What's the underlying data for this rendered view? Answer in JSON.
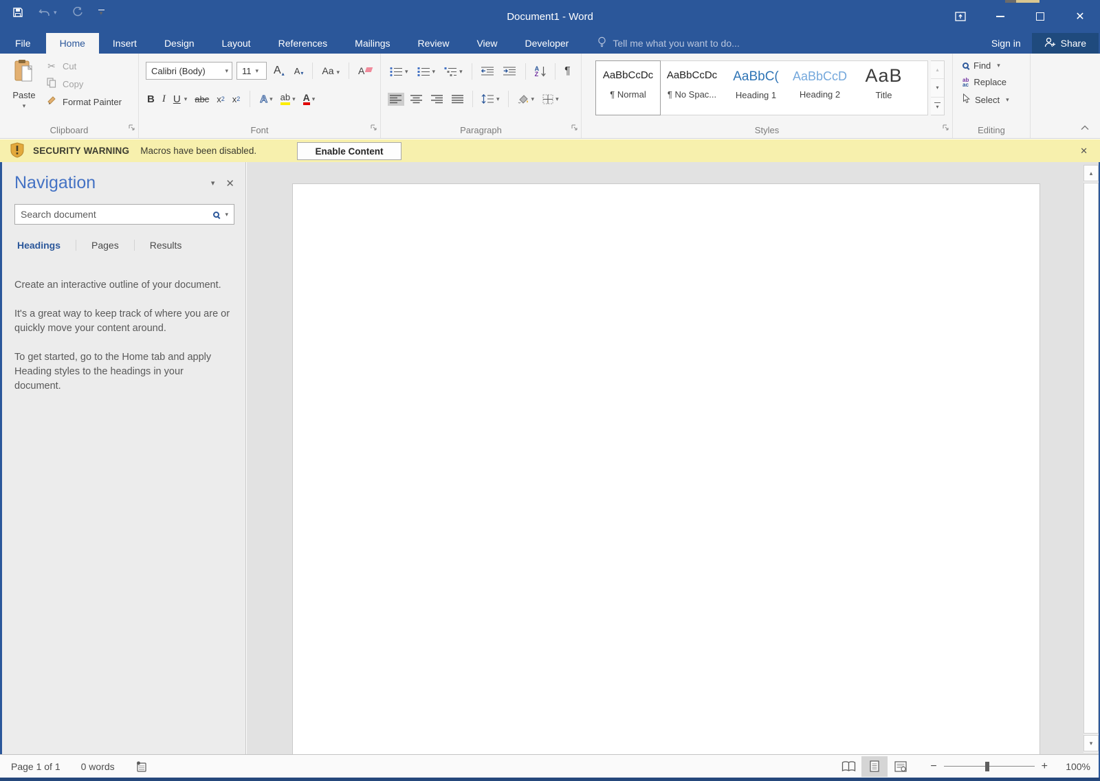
{
  "window": {
    "title": "Document1 - Word"
  },
  "glyphs": {
    "chevron_down": "▾",
    "chevron_up": "▴",
    "close": "✕",
    "pilcrow": "¶",
    "scissors": "✂",
    "minus": "−",
    "plus": "+"
  },
  "ribbon": {
    "tabs": [
      {
        "label": "File",
        "active": false
      },
      {
        "label": "Home",
        "active": true
      },
      {
        "label": "Insert",
        "active": false
      },
      {
        "label": "Design",
        "active": false
      },
      {
        "label": "Layout",
        "active": false
      },
      {
        "label": "References",
        "active": false
      },
      {
        "label": "Mailings",
        "active": false
      },
      {
        "label": "Review",
        "active": false
      },
      {
        "label": "View",
        "active": false
      },
      {
        "label": "Developer",
        "active": false
      }
    ],
    "tellme": "Tell me what you want to do...",
    "signin": "Sign in",
    "share": "Share",
    "clipboard": {
      "label": "Clipboard",
      "paste": "Paste",
      "cut": "Cut",
      "copy": "Copy",
      "format_painter": "Format Painter"
    },
    "font": {
      "label": "Font",
      "name": "Calibri (Body)",
      "size": "11",
      "bold": "B",
      "italic": "I",
      "underline": "U",
      "strikethrough": "abc",
      "subscript_base": "x",
      "subscript_mark": "2",
      "superscript_base": "x",
      "superscript_mark": "2",
      "grow_font": "A",
      "shrink_font": "A",
      "change_case": "Aa",
      "clear_formatting": "A",
      "text_effects": "A",
      "highlight": "ab",
      "font_color": "A"
    },
    "paragraph": {
      "label": "Paragraph",
      "sort_a": "A",
      "sort_z": "Z"
    },
    "styles": {
      "label": "Styles",
      "items": [
        {
          "sample": "AaBbCcDc",
          "name": "¶ Normal"
        },
        {
          "sample": "AaBbCcDc",
          "name": "¶ No Spac..."
        },
        {
          "sample": "AaBbC(",
          "name": "Heading 1"
        },
        {
          "sample": "AaBbCcD",
          "name": "Heading 2"
        },
        {
          "sample": "AaB",
          "name": "Title"
        }
      ]
    },
    "editing": {
      "label": "Editing",
      "find": "Find",
      "replace": "Replace",
      "replace_ab": "ab",
      "replace_ac": "ac",
      "select": "Select"
    }
  },
  "security": {
    "title": "SECURITY WARNING",
    "message": "Macros have been disabled.",
    "button": "Enable Content"
  },
  "navigation": {
    "title": "Navigation",
    "search_placeholder": "Search document",
    "tabs": [
      {
        "label": "Headings",
        "active": true
      },
      {
        "label": "Pages",
        "active": false
      },
      {
        "label": "Results",
        "active": false
      }
    ],
    "paragraphs": [
      "Create an interactive outline of your document.",
      "It's a great way to keep track of where you are or quickly move your content around.",
      "To get started, go to the Home tab and apply Heading styles to the headings in your document."
    ]
  },
  "statusbar": {
    "page_count": "Page 1 of 1",
    "word_count": "0 words",
    "zoom_level": "100%"
  },
  "colors": {
    "titlebar_blue": "#2b579a",
    "share_bg": "#1f4a7d",
    "security_bg": "#f7f0ad",
    "heading1_sample": "#2e74b5",
    "heading2_sample": "#74a8dc",
    "highlight_yellow": "#fded00",
    "font_color_red": "#e00000",
    "nav_title_blue": "#4472c4"
  }
}
